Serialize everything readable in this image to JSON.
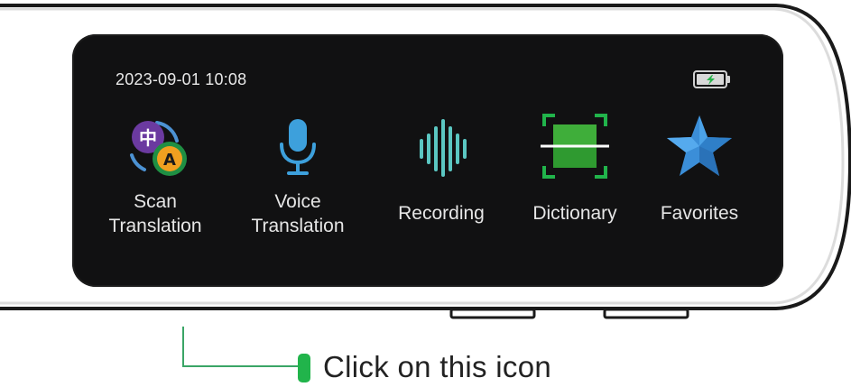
{
  "status_bar": {
    "datetime": "2023-09-01 10:08",
    "battery_icon": "battery-charging-icon"
  },
  "apps": [
    {
      "id": "scan",
      "label_line1": "Scan",
      "label_line2": "Translation",
      "icon": "scan-translation-icon"
    },
    {
      "id": "voice",
      "label_line1": "Voice",
      "label_line2": "Translation",
      "icon": "microphone-icon"
    },
    {
      "id": "recording",
      "label": "Recording",
      "icon": "sound-wave-icon"
    },
    {
      "id": "dictionary",
      "label": "Dictionary",
      "icon": "dictionary-scan-icon"
    },
    {
      "id": "favorites",
      "label": "Favorites",
      "icon": "star-icon"
    }
  ],
  "icon_glyphs": {
    "scan_han": "中",
    "scan_latin": "A"
  },
  "callout": {
    "text": "Click on this icon",
    "target": "scan"
  },
  "colors": {
    "screen_bg": "#111112",
    "accent_green": "#21b44b",
    "callout_line": "#3aa566",
    "mic_blue": "#3da0dc",
    "wave_teal": "#5bc7c2",
    "star_blue": "#3b8ed8",
    "scan_purple": "#6b3aa0",
    "scan_orange": "#f0a020"
  }
}
